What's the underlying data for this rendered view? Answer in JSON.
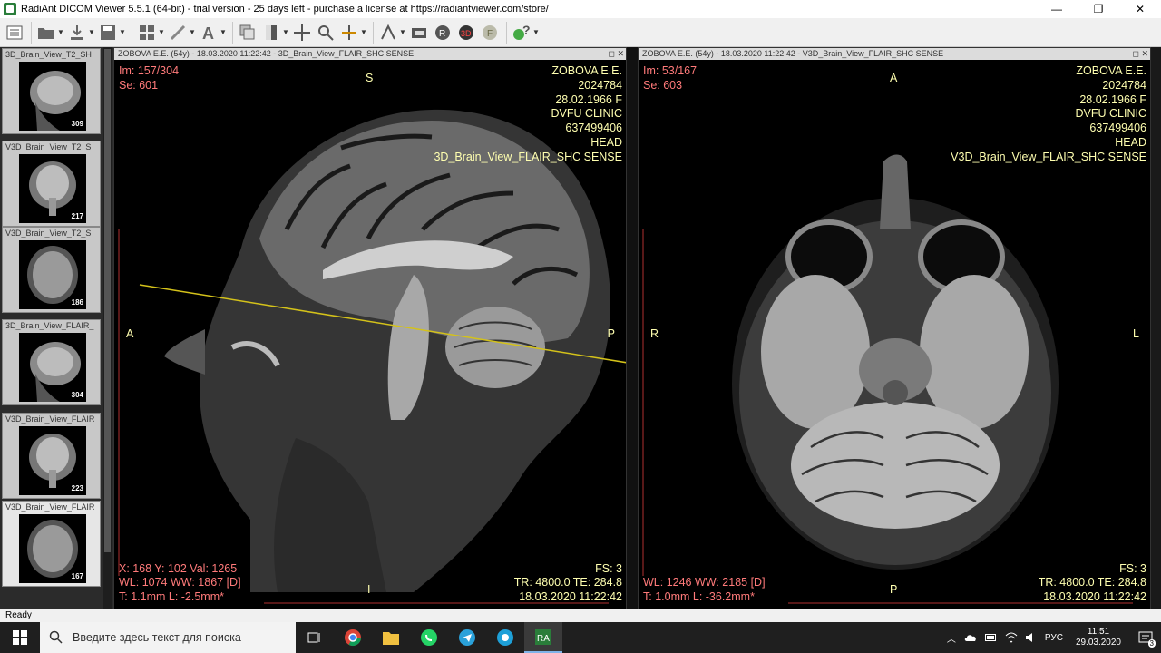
{
  "window": {
    "title": "RadiAnt DICOM Viewer 5.5.1 (64-bit) - trial version - 25 days left - purchase a license at https://radiantviewer.com/store/",
    "minimize": "—",
    "maximize": "❐",
    "close": "✕"
  },
  "toolbar": {
    "items": [
      "menu-icon",
      "open-folder-icon",
      "download-icon",
      "save-icon",
      "layout-icon",
      "measure-icon",
      "annotation-text-icon",
      "series-stack-icon",
      "window-level-icon",
      "pan-icon",
      "zoom-icon",
      "crosshair-icon",
      "ruler-tool-icon",
      "scout-icon",
      "mpr-icon",
      "3d-vr-icon",
      "fusion-icon",
      "help-icon"
    ]
  },
  "thumbnails": [
    {
      "label": "3D_Brain_View_T2_SH",
      "count": "309",
      "view": "sagittal"
    },
    {
      "label": "V3D_Brain_View_T2_S",
      "count": "217",
      "view": "coronal"
    },
    {
      "label": "V3D_Brain_View_T2_S",
      "count": "186",
      "view": "axial"
    },
    {
      "label": "3D_Brain_View_FLAIR_",
      "count": "304",
      "view": "sagittal"
    },
    {
      "label": "V3D_Brain_View_FLAIR",
      "count": "223",
      "view": "coronal"
    },
    {
      "label": "V3D_Brain_View_FLAIR",
      "count": "167",
      "view": "axial",
      "active": true
    }
  ],
  "viewport_left": {
    "header": "ZOBOVA E.E. (54y) - 18.03.2020 11:22:42 - 3D_Brain_View_FLAIR_SHC SENSE",
    "im": "Im: 157/304",
    "se": "Se: 601",
    "patient_name": "ZOBOVA E.E.",
    "patient_id": "2024784",
    "birth": "28.02.1966 F",
    "institution": "DVFU CLINIC",
    "accession": "637499406",
    "body_part": "HEAD",
    "series": "3D_Brain_View_FLAIR_SHC SENSE",
    "cursor": "X: 168 Y: 102 Val: 1265",
    "wl": "WL: 1074 WW: 1867 [D]",
    "thickness": "T: 1.1mm L: -2.5mm*",
    "fs": "FS: 3",
    "tr_te": "TR: 4800.0 TE: 284.8",
    "date": "18.03.2020 11:22:42",
    "ori_top": "S",
    "ori_bottom": "I",
    "ori_left": "A",
    "ori_right": "P"
  },
  "viewport_right": {
    "header": "ZOBOVA E.E. (54y) - 18.03.2020 11:22:42 - V3D_Brain_View_FLAIR_SHC SENSE",
    "im": "Im: 53/167",
    "se": "Se: 603",
    "patient_name": "ZOBOVA E.E.",
    "patient_id": "2024784",
    "birth": "28.02.1966 F",
    "institution": "DVFU CLINIC",
    "accession": "637499406",
    "body_part": "HEAD",
    "series": "V3D_Brain_View_FLAIR_SHC SENSE",
    "wl": "WL: 1246 WW: 2185 [D]",
    "thickness": "T: 1.0mm L: -36.2mm*",
    "fs": "FS: 3",
    "tr_te": "TR: 4800.0 TE: 284.8",
    "date": "18.03.2020 11:22:42",
    "ori_top": "A",
    "ori_bottom": "P",
    "ori_left": "R",
    "ori_right": "L"
  },
  "status": {
    "text": "Ready"
  },
  "taskbar": {
    "search_placeholder": "Введите здесь текст для поиска",
    "apps": [
      "task-view-icon",
      "chrome-icon",
      "explorer-icon",
      "whatsapp-icon",
      "telegram-icon",
      "app-icon",
      "radiant-icon"
    ],
    "language": "РУС",
    "time": "11:51",
    "date": "29.03.2020",
    "notifications": "3"
  },
  "colors": {
    "overlay_yellow": "#ffffb0",
    "overlay_red": "#ff7a7a",
    "reference_line": "#d4c21a"
  }
}
